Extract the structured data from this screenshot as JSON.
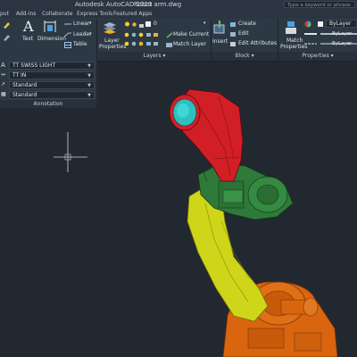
{
  "titlebar": {
    "app_title": "Autodesk AutoCAD 2020",
    "file_name": "Robot arm.dwg",
    "search_placeholder": "Type a keyword or phrase"
  },
  "menu": {
    "tabs": [
      "put",
      "Add-ins",
      "Collaborate",
      "Express Tools",
      "Featured Apps"
    ]
  },
  "ribbon": {
    "annotation_tools": {
      "text_label": "Text",
      "dimension_label": "Dimension",
      "linear_label": "Linear",
      "leader_label": "Leader",
      "table_label": "Table"
    },
    "layers": {
      "layer_properties_label_1": "Layer",
      "layer_properties_label_2": "Properties",
      "layer_value": "0",
      "make_current_label": "Make Current",
      "match_layer_label": "Match Layer",
      "panel_label": "Layers"
    },
    "block": {
      "insert_label": "Insert",
      "create_label": "Create",
      "edit_label": "Edit",
      "edit_attributes_label": "Edit Attributes",
      "panel_label": "Block"
    },
    "properties": {
      "match_label_1": "Match",
      "match_label_2": "Properties",
      "color_value": "ByLayer",
      "linetype_value": "ByLayer",
      "lineweight_value": "ByLayer",
      "panel_label": "Properties"
    }
  },
  "annotation_panel": {
    "text_style": "TT SWISS LIGHT",
    "dim_style": "TT IN",
    "leader_style": "Standard",
    "table_style": "Standard",
    "panel_label": "Annotation"
  },
  "colors": {
    "canvas_bg": "#212830",
    "robot_red": "#d21f26",
    "robot_teal": "#2fbfbf",
    "robot_green": "#2f7a3a",
    "robot_yellow": "#cfd61a",
    "robot_orange": "#d9650f",
    "layer_color": "#f2b21e"
  },
  "icons": [
    "pencil-icon",
    "text-icon",
    "dimension-icon",
    "linear-icon",
    "leader-icon",
    "table-icon",
    "layer-properties-icon",
    "lightbulb-icon",
    "sun-icon",
    "lock-icon",
    "insert-icon",
    "create-icon",
    "edit-icon",
    "edit-attributes-icon",
    "match-properties-icon",
    "color-wheel-icon",
    "crosshair-icon"
  ]
}
